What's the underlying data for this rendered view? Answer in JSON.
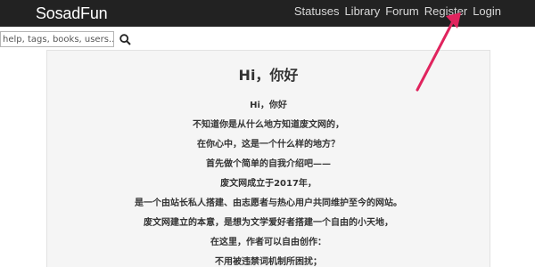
{
  "navbar": {
    "brand": "SosadFun",
    "links": [
      "Statuses",
      "Library",
      "Forum",
      "Register",
      "Login"
    ]
  },
  "search": {
    "placeholder": "help, tags, books, users...",
    "button_icon": "search-icon"
  },
  "panel": {
    "title": "Hi，你好",
    "lines": [
      "Hi，你好",
      "不知道你是从什么地方知道废文网的，",
      "在你心中，这是一个什么样的地方？",
      "首先做个简单的自我介绍吧——",
      "废文网成立于2017年，",
      "是一个由站长私人搭建、由志愿者与热心用户共同维护至今的网站。",
      "废文网建立的本意，是想为文学爱好者搭建一个自由的小天地，",
      "在这里，作者可以自由创作：",
      "不用被违禁词机制所困扰；"
    ]
  },
  "annotation": {
    "arrow_color": "#e0245e"
  }
}
